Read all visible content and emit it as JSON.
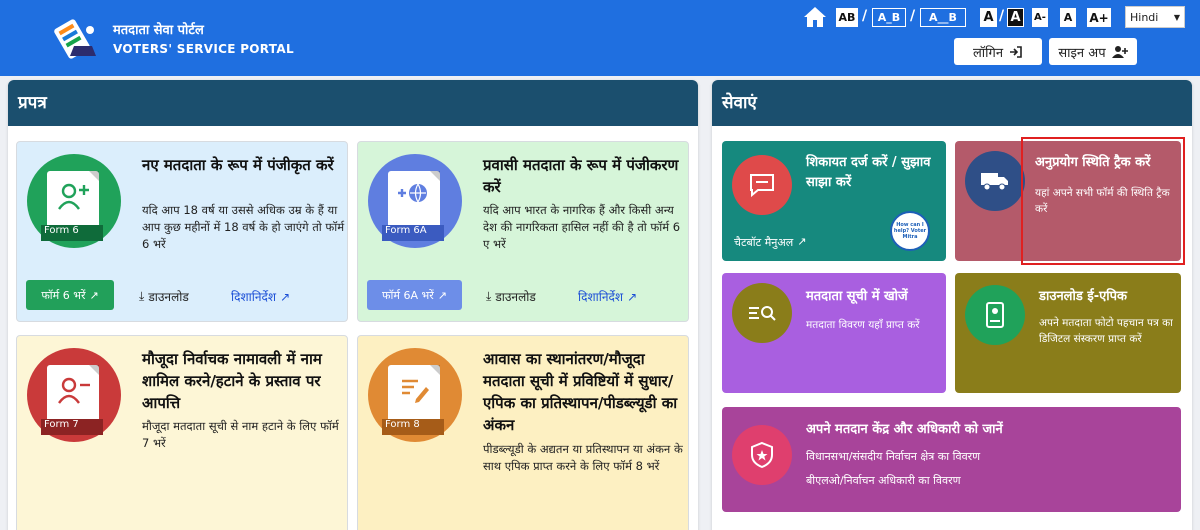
{
  "header": {
    "brand_hindi": "मतदाता सेवा पोर्टल",
    "brand_english": "VOTERS' SERVICE PORTAL",
    "text_sizes": [
      "AB",
      "A_B",
      "A__B"
    ],
    "contrast": [
      "A",
      "A"
    ],
    "font_sizes": [
      "A-",
      "A",
      "A+"
    ],
    "language": "Hindi",
    "login_label": "लॉगिन",
    "signup_label": "साइन अप"
  },
  "forms_panel": {
    "title": "प्रपत्र",
    "cards": [
      {
        "form_label": "Form 6",
        "title": "नए मतदाता के रूप में पंजीकृत करें",
        "description": "यदि आप 18 वर्ष या उससे अधिक उम्र के हैं या आप कुछ महीनों में 18 वर्ष के हो जाएंगे तो फॉर्म 6 भरें",
        "fill_button": "फॉर्म 6 भरें",
        "download": "डाउनलोड",
        "guidelines": "दिशानिर्देश"
      },
      {
        "form_label": "Form 6A",
        "title": "प्रवासी मतदाता के रूप में पंजीकरण करें",
        "description": "यदि आप भारत के नागरिक हैं और किसी अन्य देश की नागरिकता हासिल नहीं की है तो फॉर्म 6 ए भरें",
        "fill_button": "फॉर्म 6A भरें",
        "download": "डाउनलोड",
        "guidelines": "दिशानिर्देश"
      },
      {
        "form_label": "Form 7",
        "title": "मौजूदा निर्वाचक नामावली में नाम शामिल करने/हटाने के प्रस्ताव पर आपत्ति",
        "description": "मौजूदा मतदाता सूची से नाम हटाने के लिए फॉर्म 7 भरें"
      },
      {
        "form_label": "Form 8",
        "title": "आवास का स्थानांतरण/मौजूदा मतदाता सूची में प्रविष्टियों में सुधार/एपिक का प्रतिस्थापन/पीडब्ल्यूडी का अंकन",
        "description": "पीडब्ल्यूडी के अद्यतन या प्रतिस्थापन या अंकन के साथ एपिक प्राप्त करने के लिए फॉर्म 8 भरें"
      }
    ]
  },
  "services_panel": {
    "title": "सेवाएं",
    "cards": [
      {
        "title": "शिकायत दर्ज करें / सुझाव साझा करें",
        "link": "चैटबॉट मैनुअल",
        "badge": "How can I help? Voter Mitra"
      },
      {
        "title": "अनुप्रयोग स्थिति ट्रैक करें",
        "description": "यहां अपने सभी फॉर्म की स्थिति ट्रैक करें"
      },
      {
        "title": "मतदाता सूची में खोजें",
        "description": "मतदाता विवरण यहाँ प्राप्त करें"
      },
      {
        "title": "डाउनलोड ई-एपिक",
        "description": "अपने मतदाता फोटो पहचान पत्र का डिजिटल संस्करण प्राप्त करें"
      },
      {
        "title": "अपने मतदान केंद्र और अधिकारी को जानें",
        "line1": "विधानसभा/संसदीय निर्वाचन क्षेत्र का विवरण",
        "line2": "बीएलओ/निर्वाचन अधिकारी का विवरण"
      }
    ]
  },
  "colors": {
    "header": "#1f6fe0",
    "panel_head": "#1b4f6e",
    "highlight": "#e02020"
  }
}
